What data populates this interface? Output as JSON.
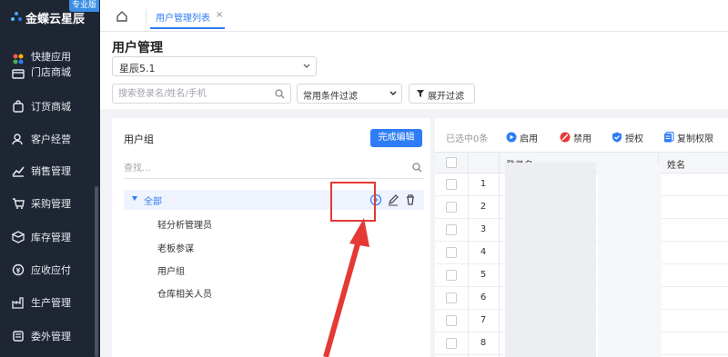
{
  "brand": {
    "name": "金蝶云星辰",
    "badge": "专业版"
  },
  "sidebar": {
    "items": [
      {
        "label": "快捷应用",
        "sub": "门店商城",
        "icon": "apps-icon"
      },
      {
        "label": "订货商城",
        "icon": "shopping-bag-icon"
      },
      {
        "label": "客户经营",
        "icon": "customer-icon"
      },
      {
        "label": "销售管理",
        "icon": "sales-chart-icon"
      },
      {
        "label": "采购管理",
        "icon": "cart-icon"
      },
      {
        "label": "库存管理",
        "icon": "inventory-icon"
      },
      {
        "label": "应收应付",
        "icon": "finance-icon"
      },
      {
        "label": "生产管理",
        "icon": "factory-icon"
      },
      {
        "label": "委外管理",
        "icon": "outsource-icon"
      }
    ]
  },
  "tabs": {
    "active_label": "用户管理列表",
    "close": "×"
  },
  "page": {
    "title": "用户管理",
    "version": "星辰5.1",
    "search_placeholder": "搜索登录名/姓名/手机",
    "filter_label": "常用条件过滤",
    "expand_label": "展开过滤"
  },
  "user_group": {
    "title": "用户组",
    "done_button": "完成编辑",
    "search_placeholder": "查找...",
    "root": "全部",
    "children": [
      "轻分析管理员",
      "老板参谋",
      "用户组",
      "仓库相关人员"
    ]
  },
  "toolbar": {
    "selected": "已选中0条",
    "enable": "启用",
    "disable": "禁用",
    "authorize": "授权",
    "copy_perm": "复制权限"
  },
  "table": {
    "columns": [
      "登录名",
      "姓名"
    ],
    "rows": [
      "1",
      "2",
      "3",
      "4",
      "5",
      "6",
      "7",
      "8"
    ]
  },
  "colors": {
    "accent": "#2e7cf6",
    "annotation": "#e53935",
    "sidebar_bg": "#1f2633"
  }
}
